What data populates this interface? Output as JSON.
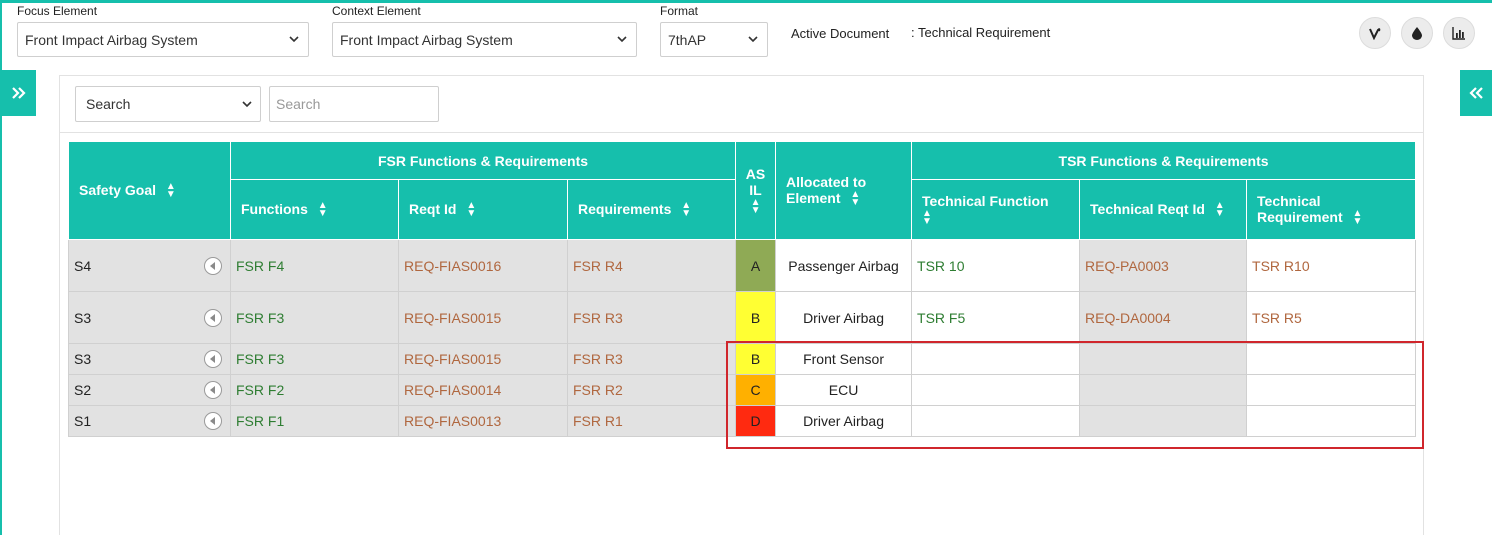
{
  "header": {
    "focus_label": "Focus Element",
    "focus_value": "Front Impact Airbag System",
    "context_label": "Context Element",
    "context_value": "Front Impact Airbag System",
    "format_label": "Format",
    "format_value": "7thAP",
    "active_doc_label": "Active Document",
    "active_doc_value": ": Technical Requirement",
    "icons": [
      "vine-icon",
      "drop-icon",
      "bar-chart-icon"
    ]
  },
  "toggles": {
    "left_icon": "double-chevron-right-icon",
    "right_icon": "double-chevron-left-icon"
  },
  "search": {
    "select_value": "Search",
    "input_placeholder": "Search"
  },
  "table": {
    "group_headers": {
      "fsr": "FSR Functions & Requirements",
      "tsr": "TSR Functions & Requirements"
    },
    "columns": {
      "safety_goal": "Safety Goal",
      "functions": "Functions",
      "reqt_id": "Reqt Id",
      "requirements": "Requirements",
      "asil_line1": "AS",
      "asil_line2": "IL",
      "allocated_line1": "Allocated to",
      "allocated_line2": "Element",
      "tech_function": "Technical Function",
      "tech_reqt_id": "Technical Reqt Id",
      "tech_req_line1": "Technical",
      "tech_req_line2": "Requirement"
    },
    "rows": [
      {
        "sg": "S4",
        "func": "FSR F4",
        "reqid": "REQ-FIAS0016",
        "req": "FSR R4",
        "asil": "A",
        "asil_color": "#8faa55",
        "alloc": "Passenger Airbag",
        "tfunc": "TSR 10",
        "treqid": "REQ-PA0003",
        "treq": "TSR R10"
      },
      {
        "sg": "S3",
        "func": "FSR F3",
        "reqid": "REQ-FIAS0015",
        "req": "FSR R3",
        "asil": "B",
        "asil_color": "#ffff33",
        "alloc": "Driver Airbag",
        "tfunc": "TSR F5",
        "treqid": "REQ-DA0004",
        "treq": "TSR R5"
      },
      {
        "sg": "S3",
        "func": "FSR F3",
        "reqid": "REQ-FIAS0015",
        "req": "FSR R3",
        "asil": "B",
        "asil_color": "#ffff33",
        "alloc": "Front Sensor",
        "tfunc": "",
        "treqid": "",
        "treq": ""
      },
      {
        "sg": "S2",
        "func": "FSR F2",
        "reqid": "REQ-FIAS0014",
        "req": "FSR R2",
        "asil": "C",
        "asil_color": "#ffb000",
        "alloc": "ECU",
        "tfunc": "",
        "treqid": "",
        "treq": ""
      },
      {
        "sg": "S1",
        "func": "FSR F1",
        "reqid": "REQ-FIAS0013",
        "req": "FSR R1",
        "asil": "D",
        "asil_color": "#ff2a10",
        "alloc": "Driver Airbag",
        "tfunc": "",
        "treqid": "",
        "treq": ""
      }
    ]
  },
  "colors": {
    "accent": "#16bfac",
    "highlight": "#d0262c",
    "fsr_function_text": "#2e7d32",
    "requirement_text": "#b0673f"
  }
}
